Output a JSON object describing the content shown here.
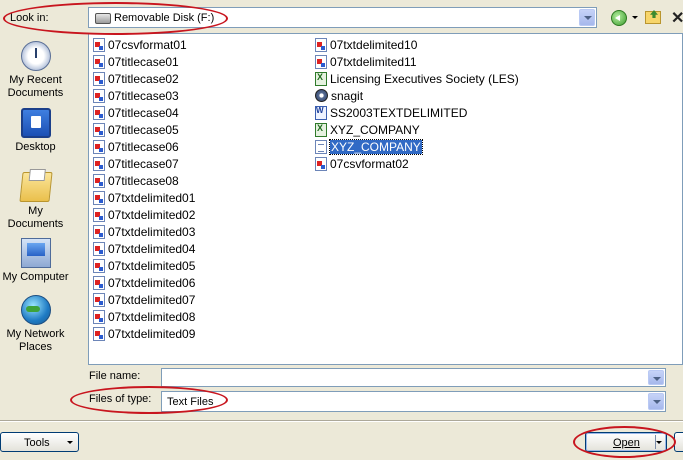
{
  "colors": {
    "accent": "#316ac5",
    "annotation": "#c8151e",
    "border": "#7f9db9",
    "dialog_bg": "#ece9d8"
  },
  "lookin": {
    "label": "Look in:",
    "value": "Removable Disk (F:)"
  },
  "toolbar": {
    "back_icon": "back-icon",
    "up_icon": "up-folder-icon",
    "close": "✕"
  },
  "places": [
    {
      "label": "My Recent\nDocuments",
      "icon": "recent-documents-icon"
    },
    {
      "label": "Desktop",
      "icon": "desktop-icon"
    },
    {
      "label": "My Documents",
      "icon": "my-documents-icon"
    },
    {
      "label": "My Computer",
      "icon": "my-computer-icon"
    },
    {
      "label": "My Network\nPlaces",
      "icon": "network-places-icon"
    }
  ],
  "files": {
    "col1": [
      {
        "name": "07csvformat01",
        "type": "generic"
      },
      {
        "name": "07titlecase01",
        "type": "generic"
      },
      {
        "name": "07titlecase02",
        "type": "generic"
      },
      {
        "name": "07titlecase03",
        "type": "generic"
      },
      {
        "name": "07titlecase04",
        "type": "generic"
      },
      {
        "name": "07titlecase05",
        "type": "generic"
      },
      {
        "name": "07titlecase06",
        "type": "generic"
      },
      {
        "name": "07titlecase07",
        "type": "generic"
      },
      {
        "name": "07titlecase08",
        "type": "generic"
      },
      {
        "name": "07txtdelimited01",
        "type": "generic"
      },
      {
        "name": "07txtdelimited02",
        "type": "generic"
      },
      {
        "name": "07txtdelimited03",
        "type": "generic"
      },
      {
        "name": "07txtdelimited04",
        "type": "generic"
      },
      {
        "name": "07txtdelimited05",
        "type": "generic"
      },
      {
        "name": "07txtdelimited06",
        "type": "generic"
      },
      {
        "name": "07txtdelimited07",
        "type": "generic"
      },
      {
        "name": "07txtdelimited08",
        "type": "generic"
      },
      {
        "name": "07txtdelimited09",
        "type": "generic"
      }
    ],
    "col2": [
      {
        "name": "07txtdelimited10",
        "type": "generic"
      },
      {
        "name": "07txtdelimited11",
        "type": "generic"
      },
      {
        "name": "Licensing Executives Society (LES)",
        "type": "excel"
      },
      {
        "name": "snagit",
        "type": "snagit"
      },
      {
        "name": "SS2003TEXTDELIMITED",
        "type": "word"
      },
      {
        "name": "XYZ_COMPANY",
        "type": "excel"
      },
      {
        "name": "XYZ_COMPANY",
        "type": "text",
        "selected": true
      },
      {
        "name": "07csvformat02",
        "type": "generic"
      }
    ]
  },
  "filename": {
    "label": "File name:",
    "value": ""
  },
  "filetype": {
    "label": "Files of type:",
    "value": "Text Files"
  },
  "buttons": {
    "tools": "Tools",
    "open": "Open"
  }
}
